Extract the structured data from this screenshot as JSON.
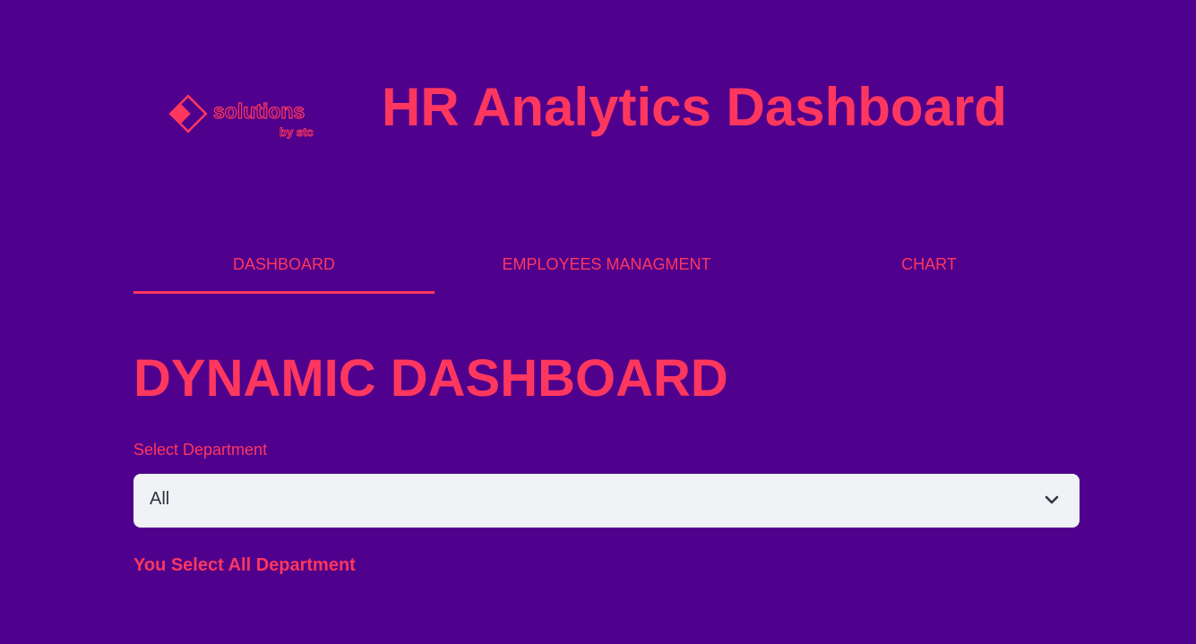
{
  "header": {
    "logo_text": "solutions",
    "logo_subtext": "by stc",
    "title": "HR Analytics Dashboard"
  },
  "tabs": [
    {
      "label": "DASHBOARD",
      "active": true
    },
    {
      "label": "EMPLOYEES MANAGMENT",
      "active": false
    },
    {
      "label": "CHART",
      "active": false
    }
  ],
  "main": {
    "heading": "DYNAMIC DASHBOARD",
    "select_label": "Select Department",
    "select_value": "All",
    "status_text": "You Select All Department"
  },
  "icons": {
    "logo": "solutions-by-stc-logo",
    "select_arrow": "chevron-down-icon"
  },
  "colors": {
    "background": "#4f008c",
    "accent": "#ff375e",
    "select_background": "#f0f2f6",
    "select_text": "#31333f"
  }
}
